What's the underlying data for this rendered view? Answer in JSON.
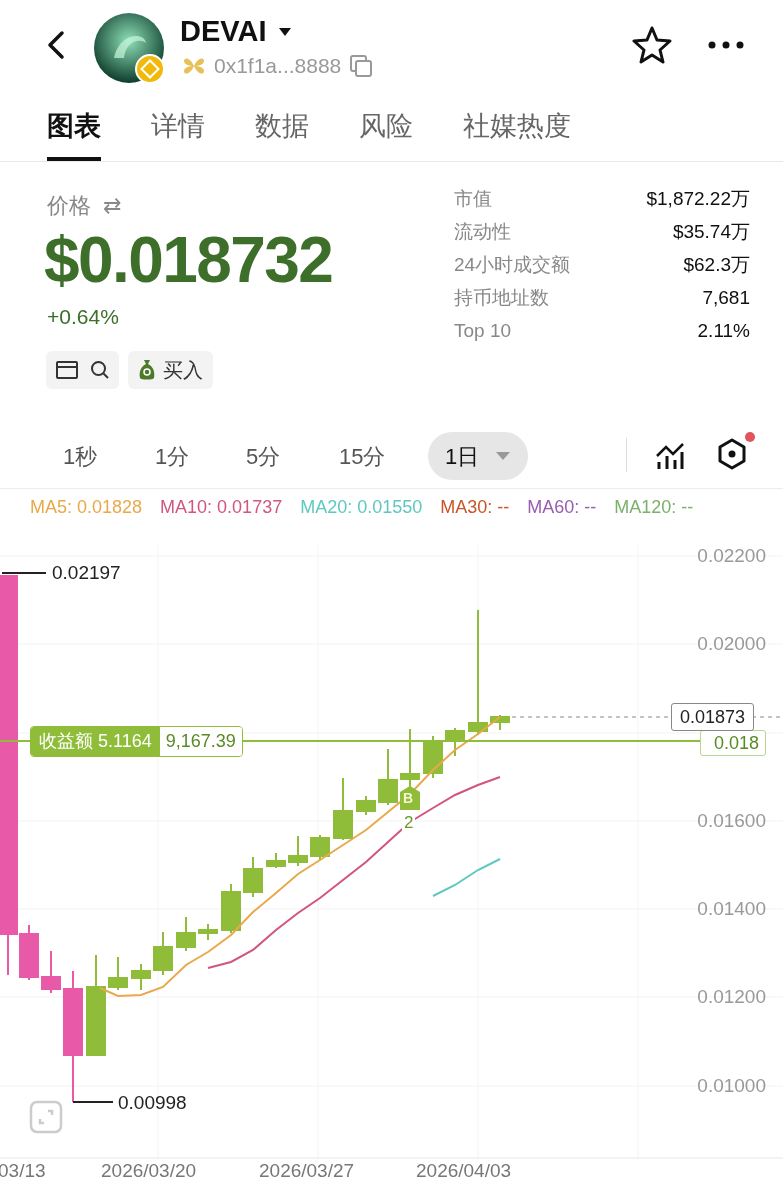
{
  "header": {
    "title": "DEVAI",
    "address": "0x1f1a...8888"
  },
  "tabs": [
    {
      "label": "图表",
      "selected": true
    },
    {
      "label": "详情",
      "selected": false
    },
    {
      "label": "数据",
      "selected": false
    },
    {
      "label": "风险",
      "selected": false
    },
    {
      "label": "社媒热度",
      "selected": false
    }
  ],
  "price": {
    "label": "价格",
    "swap_icon": "⇄",
    "value": "$0.018732",
    "change": "+0.64%"
  },
  "stats": [
    {
      "label": "市值",
      "value": "$1,872.22万"
    },
    {
      "label": "流动性",
      "value": "$35.74万"
    },
    {
      "label": "24小时成交额",
      "value": "$62.3万"
    },
    {
      "label": "持币地址数",
      "value": "7,681"
    },
    {
      "label": "Top 10",
      "value": "2.11%"
    }
  ],
  "buy_button": "买入",
  "intervals": [
    {
      "label": "1秒",
      "selected": false
    },
    {
      "label": "1分",
      "selected": false
    },
    {
      "label": "5分",
      "selected": false
    },
    {
      "label": "15分",
      "selected": false
    },
    {
      "label": "1日",
      "selected": true
    }
  ],
  "settings_dot": true,
  "ma_legend": [
    {
      "label": "MA5: 0.01828",
      "color": "#e8a94a"
    },
    {
      "label": "MA10: 0.01737",
      "color": "#d0557f"
    },
    {
      "label": "MA20: 0.01550",
      "color": "#5ec8c0"
    },
    {
      "label": "MA30: --",
      "color": "#c8552a"
    },
    {
      "label": "MA60: --",
      "color": "#9a5cb0"
    },
    {
      "label": "MA120: --",
      "color": "#7ab06a"
    }
  ],
  "chart": {
    "y_labels": [
      "0.02200",
      "0.02000",
      "0.01600",
      "0.01400",
      "0.01200",
      "0.01000"
    ],
    "x_labels": [
      "03/13",
      "2026/03/20",
      "2026/03/27",
      "2026/04/03"
    ],
    "high_label": "0.02197",
    "low_label": "0.00998",
    "position": {
      "label": "收益额 5.1164",
      "value": "9,167.39"
    },
    "current_price": "0.01873",
    "entry_price": "0.018",
    "marker": {
      "letter": "B",
      "count": "2"
    }
  }
}
